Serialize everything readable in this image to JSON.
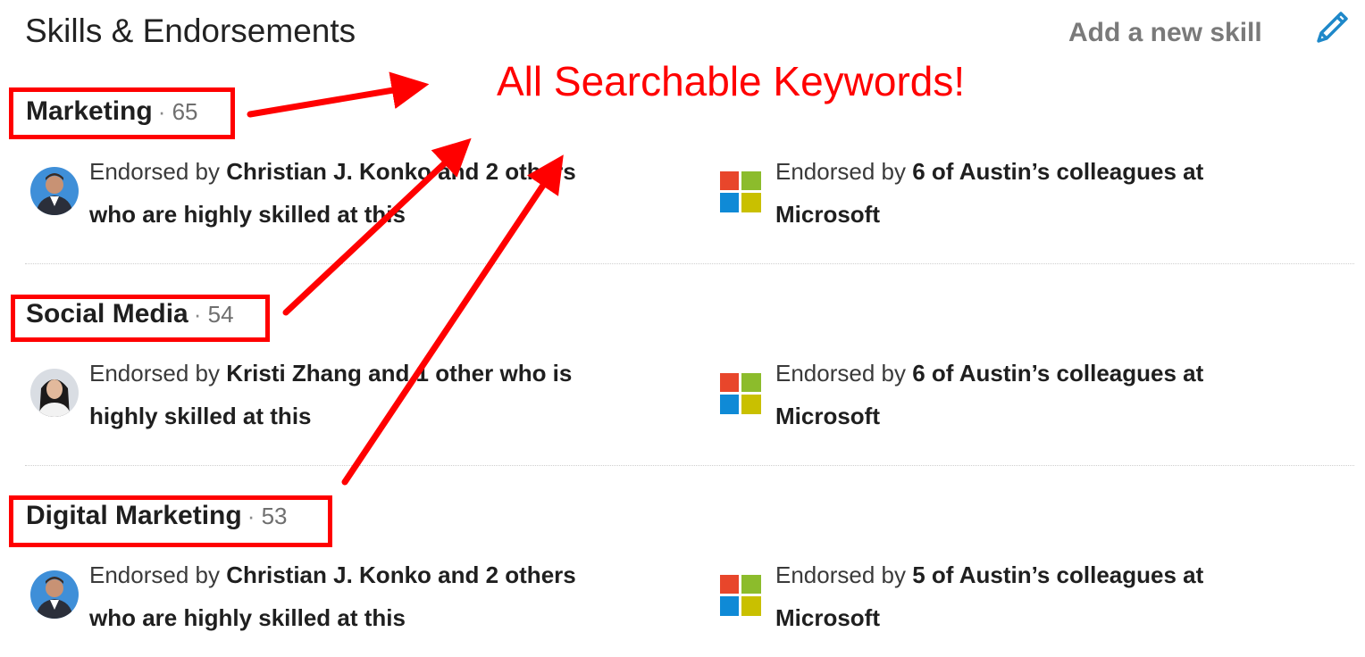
{
  "header": {
    "title": "Skills & Endorsements",
    "add_skill_label": "Add a new skill"
  },
  "annotation": {
    "text": "All Searchable Keywords!",
    "color": "#ff0000"
  },
  "skills": [
    {
      "name": "Marketing",
      "count": "65",
      "people_endorsement": {
        "prefix": "Endorsed by ",
        "bold": "Christian J. Konko and 2 others",
        "line2": "who are highly skilled at this",
        "avatar": "man-in-suit-avatar"
      },
      "company_endorsement": {
        "prefix": "Endorsed by ",
        "bold": "6 of Austin’s colleagues at",
        "line2": "Microsoft",
        "icon": "microsoft-logo-icon"
      }
    },
    {
      "name": "Social Media",
      "count": "54",
      "people_endorsement": {
        "prefix": "Endorsed by ",
        "bold": "Kristi Zhang and 1 other who is",
        "line2": "highly skilled at this",
        "avatar": "woman-avatar"
      },
      "company_endorsement": {
        "prefix": "Endorsed by ",
        "bold": "6 of Austin’s colleagues at",
        "line2": "Microsoft",
        "icon": "microsoft-logo-icon"
      }
    },
    {
      "name": "Digital Marketing",
      "count": "53",
      "people_endorsement": {
        "prefix": "Endorsed by ",
        "bold": "Christian J. Konko and 2 others",
        "line2": "who are highly skilled at this",
        "avatar": "man-in-suit-avatar"
      },
      "company_endorsement": {
        "prefix": "Endorsed by ",
        "bold": "5 of Austin’s colleagues at",
        "line2": "Microsoft",
        "icon": "microsoft-logo-icon"
      }
    }
  ],
  "colors": {
    "ms_red": "#e8462b",
    "ms_green": "#8cbc2c",
    "ms_blue": "#0f8ad6",
    "ms_yellow": "#c9c000",
    "edit_icon": "#1e88c9"
  }
}
